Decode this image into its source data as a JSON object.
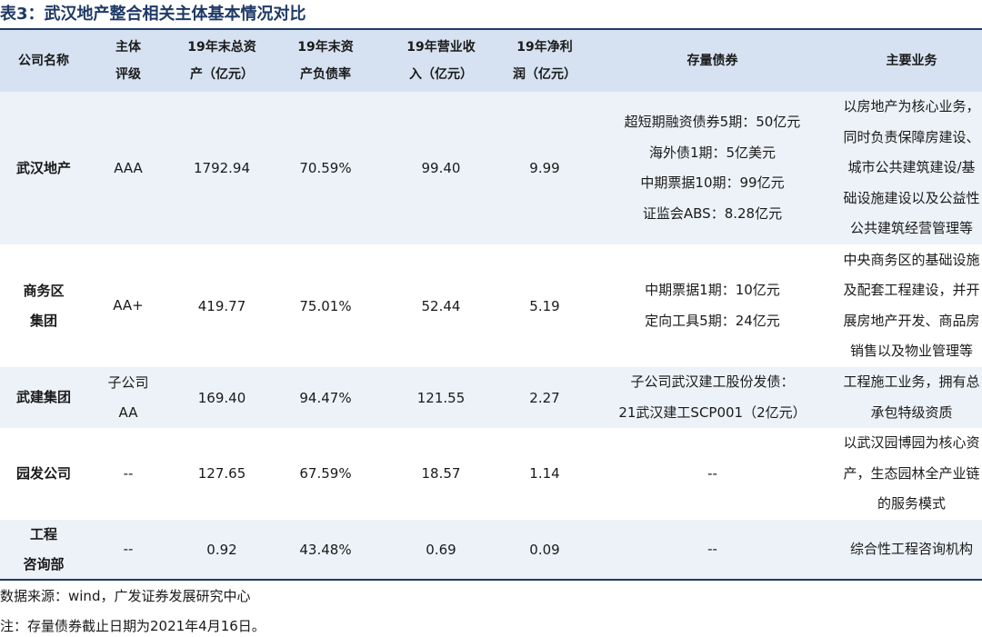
{
  "title": "表3：武汉地产整合相关主体基本情况对比",
  "headers": {
    "company": [
      "公司名称"
    ],
    "rating": [
      "主体",
      "评级"
    ],
    "assets": [
      "19年末总资",
      "产（亿元）"
    ],
    "debt_ratio": [
      "19年末资",
      "产负债率"
    ],
    "revenue": [
      "19年营业收",
      "入（亿元）"
    ],
    "profit": [
      "19年净利",
      "润（亿元）"
    ],
    "bonds": [
      "存量债券"
    ],
    "business": [
      "主要业务"
    ]
  },
  "rows": [
    {
      "company": [
        "武汉地产"
      ],
      "rating": [
        "AAA"
      ],
      "assets": "1792.94",
      "debt_ratio": "70.59%",
      "revenue": "99.40",
      "profit": "9.99",
      "bonds": [
        "超短期融资债券5期：50亿元",
        "海外债1期：5亿美元",
        "中期票据10期：99亿元",
        "证监会ABS：8.28亿元"
      ],
      "business": [
        "以房地产为核心业务，",
        "同时负责保障房建设、",
        "城市公共建筑建设/基",
        "础设施建设以及公益性",
        "公共建筑经营管理等"
      ]
    },
    {
      "company": [
        "商务区",
        "集团"
      ],
      "rating": [
        "AA+"
      ],
      "assets": "419.77",
      "debt_ratio": "75.01%",
      "revenue": "52.44",
      "profit": "5.19",
      "bonds": [
        "中期票据1期：10亿元",
        "定向工具5期：24亿元"
      ],
      "business": [
        "中央商务区的基础设施",
        "及配套工程建设，并开",
        "展房地产开发、商品房",
        "销售以及物业管理等"
      ]
    },
    {
      "company": [
        "武建集团"
      ],
      "rating": [
        "子公司",
        "AA"
      ],
      "assets": "169.40",
      "debt_ratio": "94.47%",
      "revenue": "121.55",
      "profit": "2.27",
      "bonds": [
        "子公司武汉建工股份发债：",
        "21武汉建工SCP001（2亿元）"
      ],
      "business": [
        "工程施工业务，拥有总",
        "承包特级资质"
      ]
    },
    {
      "company": [
        "园发公司"
      ],
      "rating": [
        "--"
      ],
      "assets": "127.65",
      "debt_ratio": "67.59%",
      "revenue": "18.57",
      "profit": "1.14",
      "bonds": [
        "--"
      ],
      "business": [
        "以武汉园博园为核心资",
        "产，生态园林全产业链",
        "的服务模式"
      ]
    },
    {
      "company": [
        "工程",
        "咨询部"
      ],
      "rating": [
        "--"
      ],
      "assets": "0.92",
      "debt_ratio": "43.48%",
      "revenue": "0.69",
      "profit": "0.09",
      "bonds": [
        "--"
      ],
      "business": [
        "综合性工程咨询机构"
      ]
    }
  ],
  "footer": {
    "source": "数据来源：wind，广发证券发展研究中心",
    "note": "注：存量债券截止日期为2021年4月16日。"
  },
  "colors": {
    "accent": "#1f3a66",
    "header_bg": "#d6e2f1",
    "shade_bg": "#edf2f8"
  }
}
